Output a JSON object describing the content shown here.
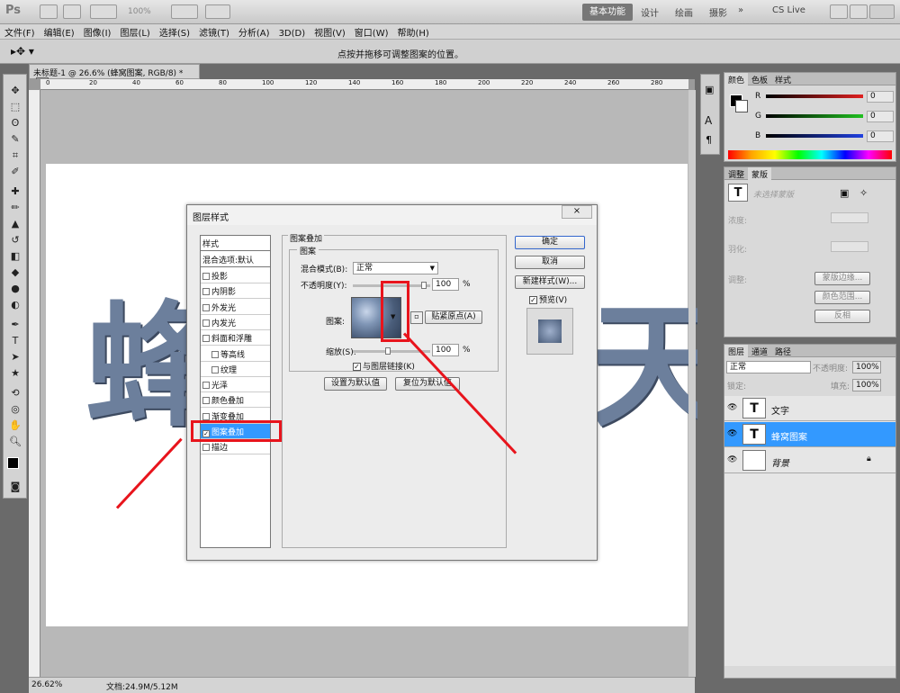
{
  "app": {
    "logo": "Ps",
    "zoom": "100%",
    "workspaces": [
      "基本功能",
      "设计",
      "绘画",
      "摄影"
    ],
    "cslive": "CS Live"
  },
  "menu": [
    "文件(F)",
    "编辑(E)",
    "图像(I)",
    "图层(L)",
    "选择(S)",
    "滤镜(T)",
    "分析(A)",
    "3D(D)",
    "视图(V)",
    "窗口(W)",
    "帮助(H)"
  ],
  "options": {
    "hint": "点按并拖移可调整图案的位置。"
  },
  "document": {
    "tab_title": "未标题-1 @ 26.6% (蜂窝图案, RGB/8) *",
    "ruler_ticks": [
      "0",
      "20",
      "40",
      "60",
      "80",
      "100",
      "120",
      "140",
      "160",
      "180",
      "200",
      "220",
      "240",
      "260",
      "280"
    ],
    "canvas_text": "蜂蜜",
    "canvas_text_right": "天",
    "status_zoom": "26.62%",
    "status_doc": "文档:24.9M/5.12M"
  },
  "color_panel": {
    "tabs": [
      "颜色",
      "色板",
      "样式"
    ],
    "rows": [
      {
        "label": "R",
        "value": "0",
        "color": "#e02020"
      },
      {
        "label": "G",
        "value": "0",
        "color": "#20c020"
      },
      {
        "label": "B",
        "value": "0",
        "color": "#2040e0"
      }
    ]
  },
  "adjust_panel": {
    "tabs": [
      "调整",
      "蒙版"
    ],
    "no_mask": "未选择蒙版",
    "density": "浓度:",
    "feather": "羽化:",
    "refine": "调整:",
    "buttons": [
      "蒙版边缘...",
      "颜色范围...",
      "反相"
    ]
  },
  "layers_panel": {
    "tabs": [
      "图层",
      "通道",
      "路径"
    ],
    "blend": "正常",
    "opacity_label": "不透明度:",
    "opacity": "100%",
    "lock_label": "锁定:",
    "fill_label": "填充:",
    "fill": "100%",
    "layers": [
      {
        "name": "文字",
        "thumb": "T",
        "selected": false
      },
      {
        "name": "蜂窝图案",
        "thumb": "T",
        "selected": true
      },
      {
        "name": "背景",
        "thumb": "",
        "selected": false
      }
    ]
  },
  "dialog": {
    "title": "图层样式",
    "style_header": "样式",
    "blend_default": "混合选项:默认",
    "items": [
      {
        "label": "投影",
        "checked": false,
        "indent": false
      },
      {
        "label": "内阴影",
        "checked": false,
        "indent": false
      },
      {
        "label": "外发光",
        "checked": false,
        "indent": false
      },
      {
        "label": "内发光",
        "checked": false,
        "indent": false
      },
      {
        "label": "斜面和浮雕",
        "checked": false,
        "indent": false
      },
      {
        "label": "等高线",
        "checked": false,
        "indent": true
      },
      {
        "label": "纹理",
        "checked": false,
        "indent": true
      },
      {
        "label": "光泽",
        "checked": false,
        "indent": false
      },
      {
        "label": "颜色叠加",
        "checked": false,
        "indent": false
      },
      {
        "label": "渐变叠加",
        "checked": false,
        "indent": false
      },
      {
        "label": "图案叠加",
        "checked": true,
        "indent": false
      },
      {
        "label": "描边",
        "checked": false,
        "indent": false
      }
    ],
    "group_title": "图案叠加",
    "sub_group": "图案",
    "blend_mode_label": "混合模式(B):",
    "blend_mode": "正常",
    "opacity_label": "不透明度(Y):",
    "opacity": "100",
    "opacity_unit": "%",
    "pattern_label": "图案:",
    "snap_origin": "贴紧原点(A)",
    "scale_label": "缩放(S):",
    "scale": "100",
    "scale_unit": "%",
    "link_layer": "与图层链接(K)",
    "set_default": "设置为默认值",
    "reset_default": "复位为默认值",
    "ok": "确定",
    "cancel": "取消",
    "new_style": "新建样式(W)...",
    "preview": "预览(V)"
  }
}
